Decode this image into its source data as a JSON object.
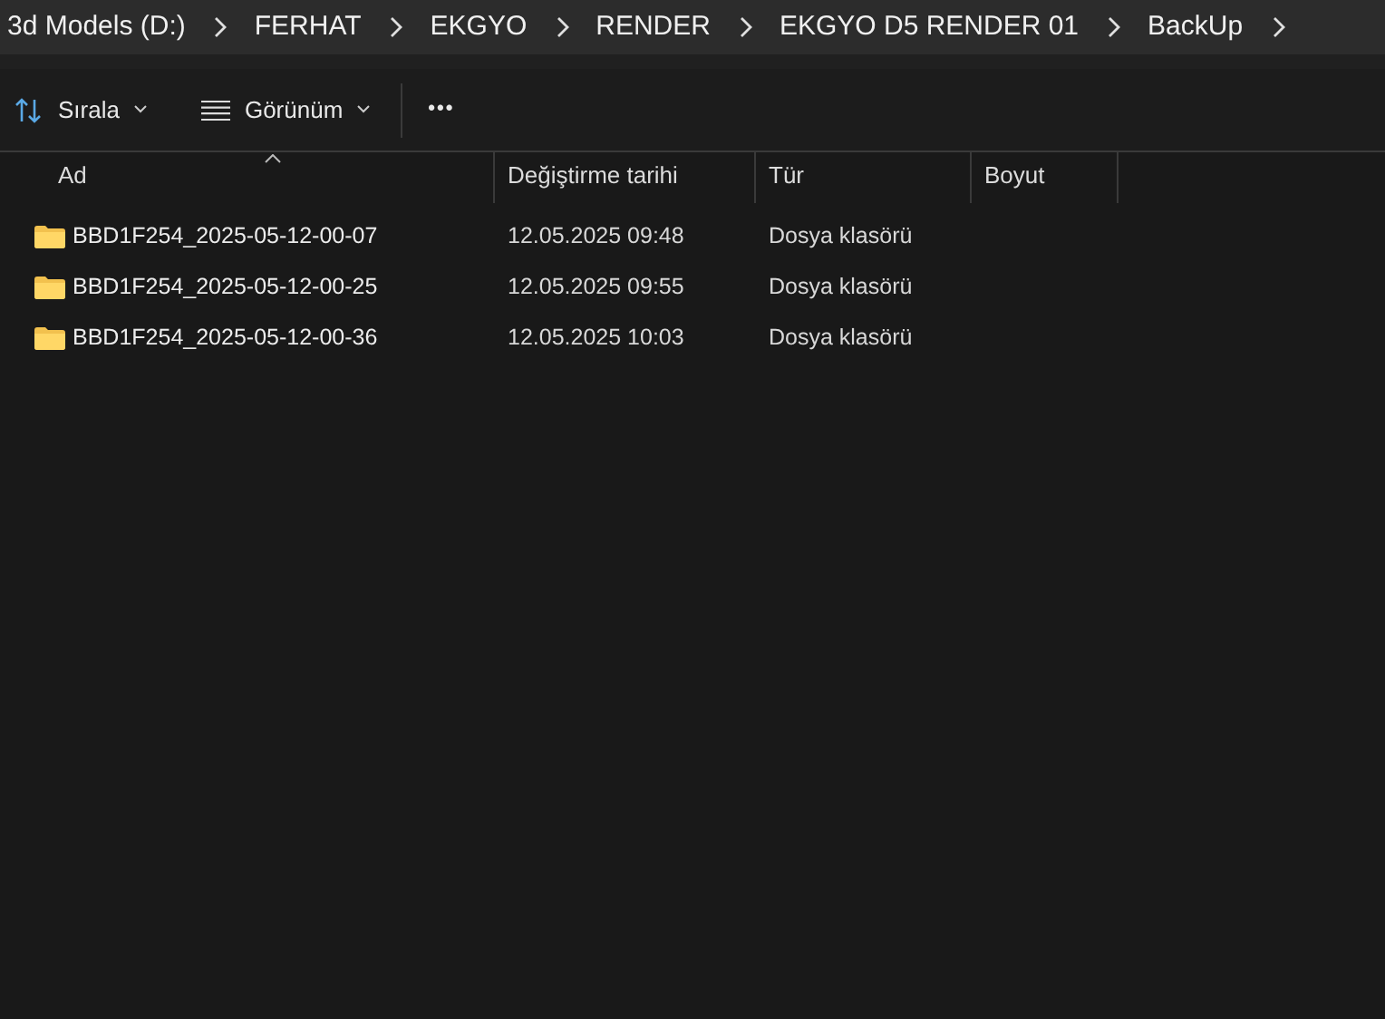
{
  "breadcrumb": [
    "3d Models (D:)",
    "FERHAT",
    "EKGYO",
    "RENDER",
    "EKGYO D5 RENDER 01",
    "BackUp"
  ],
  "toolbar": {
    "sort_label": "Sırala",
    "view_label": "Görünüm",
    "more": "•••"
  },
  "table": {
    "columns": [
      "Ad",
      "Değiştirme tarihi",
      "Tür",
      "Boyut"
    ],
    "rows": [
      {
        "name": "BBD1F254_2025-05-12-00-07",
        "modified": "12.05.2025 09:48",
        "type": "Dosya klasörü"
      },
      {
        "name": "BBD1F254_2025-05-12-00-25",
        "modified": "12.05.2025 09:55",
        "type": "Dosya klasörü"
      },
      {
        "name": "BBD1F254_2025-05-12-00-36",
        "modified": "12.05.2025 10:03",
        "type": "Dosya klasörü"
      }
    ]
  }
}
